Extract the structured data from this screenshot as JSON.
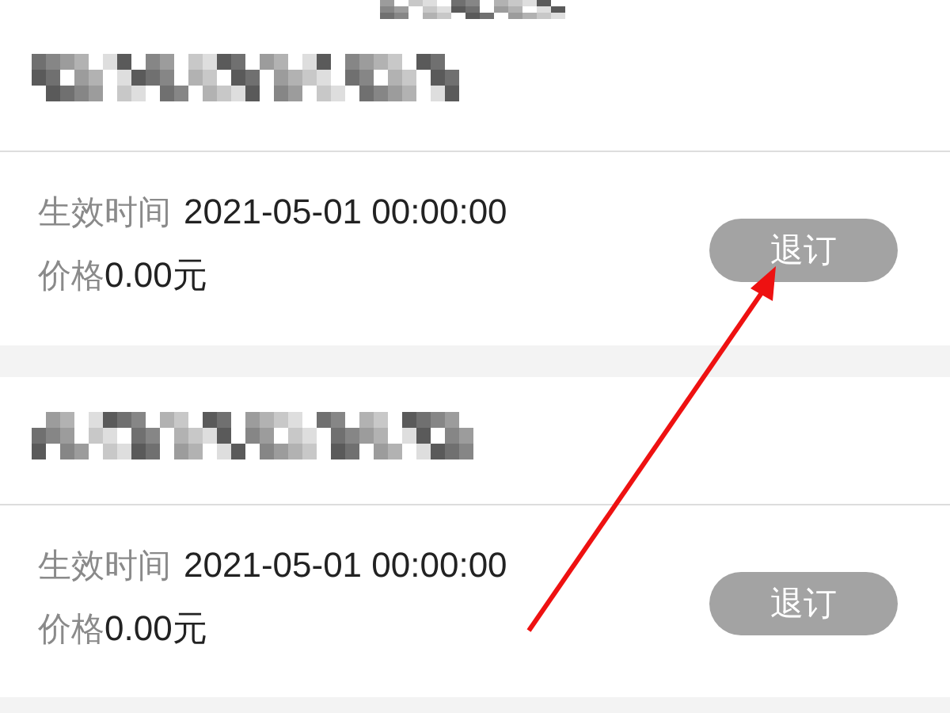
{
  "records": [
    {
      "effective_label": "生效时间",
      "effective_time": "2021-05-01 00:00:00",
      "price_label": "价格",
      "price": "0.00元",
      "button": "退订"
    },
    {
      "effective_label": "生效时间",
      "effective_time": "2021-05-01 00:00:00",
      "price_label": "价格",
      "price": "0.00元",
      "button": "退订"
    }
  ]
}
